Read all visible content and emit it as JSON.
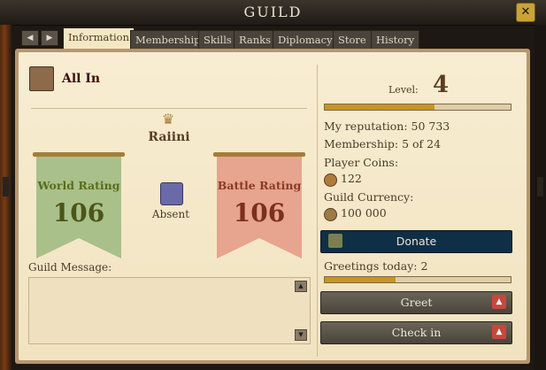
{
  "window": {
    "title": "Guild",
    "close_label": "✕"
  },
  "tabs": [
    {
      "label": "Information",
      "active": true
    },
    {
      "label": "Membership"
    },
    {
      "label": "Skills"
    },
    {
      "label": "Ranks"
    },
    {
      "label": "Diplomacy"
    },
    {
      "label": "Store"
    },
    {
      "label": "History"
    }
  ],
  "nav": {
    "prev": "◀",
    "next": "▶"
  },
  "guild": {
    "name": "All In",
    "leader": "Raiini",
    "leader_status": "Absent"
  },
  "ratings": {
    "world": {
      "label": "World Rating",
      "value": "106"
    },
    "battle": {
      "label": "Battle Rating",
      "value": "106"
    }
  },
  "message": {
    "label": "Guild Message:",
    "text": ""
  },
  "stats": {
    "level_label": "Level:",
    "level": "4",
    "level_progress": 0.59,
    "reputation": "My reputation: 50 733",
    "membership": "Membership: 5 of 24",
    "player_coins_label": "Player Coins:",
    "player_coins": "122",
    "guild_currency_label": "Guild Currency:",
    "guild_currency": "100 000",
    "greetings": "Greetings today: 2",
    "greetings_progress": 0.38
  },
  "buttons": {
    "donate": "Donate",
    "greet": "Greet",
    "checkin": "Check in"
  },
  "colors": {
    "world_banner": "#a9c08a",
    "battle_banner": "#e7a48e",
    "accent": "#c8951f"
  }
}
